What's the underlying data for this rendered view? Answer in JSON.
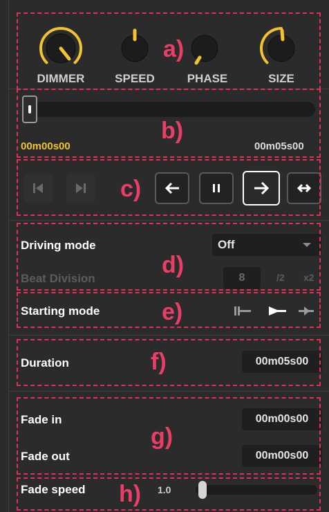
{
  "knobs": [
    {
      "label": "DIMMER",
      "level": 0.85
    },
    {
      "label": "SPEED",
      "level": 0.5
    },
    {
      "label": "PHASE",
      "level": 0.15
    },
    {
      "label": "SIZE",
      "level": 0.55
    }
  ],
  "timeline": {
    "position": 0.0,
    "current_time": "00m00s00",
    "end_time": "00m05s00"
  },
  "transport": {
    "buttons": [
      "skip-to-start",
      "skip-to-end",
      "play-backward",
      "pause",
      "play-forward",
      "ping-pong"
    ],
    "active": "play-forward"
  },
  "driving": {
    "label": "Driving mode",
    "value": "Off",
    "beat_label": "Beat Division",
    "beat_value": "8",
    "div2": "/2",
    "mul2": "x2"
  },
  "starting": {
    "label": "Starting mode",
    "selected": "middle"
  },
  "duration": {
    "label": "Duration",
    "value": "00m05s00"
  },
  "fade": {
    "in_label": "Fade in",
    "in_value": "00m00s00",
    "out_label": "Fade out",
    "out_value": "00m00s00",
    "speed_label": "Fade speed",
    "speed_value": "1.0",
    "speed_level": 0.0
  },
  "annotations": [
    "a)",
    "b)",
    "c)",
    "d)",
    "e)",
    "f)",
    "g)",
    "h)"
  ],
  "colors": {
    "accent": "#f2c230",
    "annotation": "#e0335a",
    "panel": "#2b2b2b"
  }
}
